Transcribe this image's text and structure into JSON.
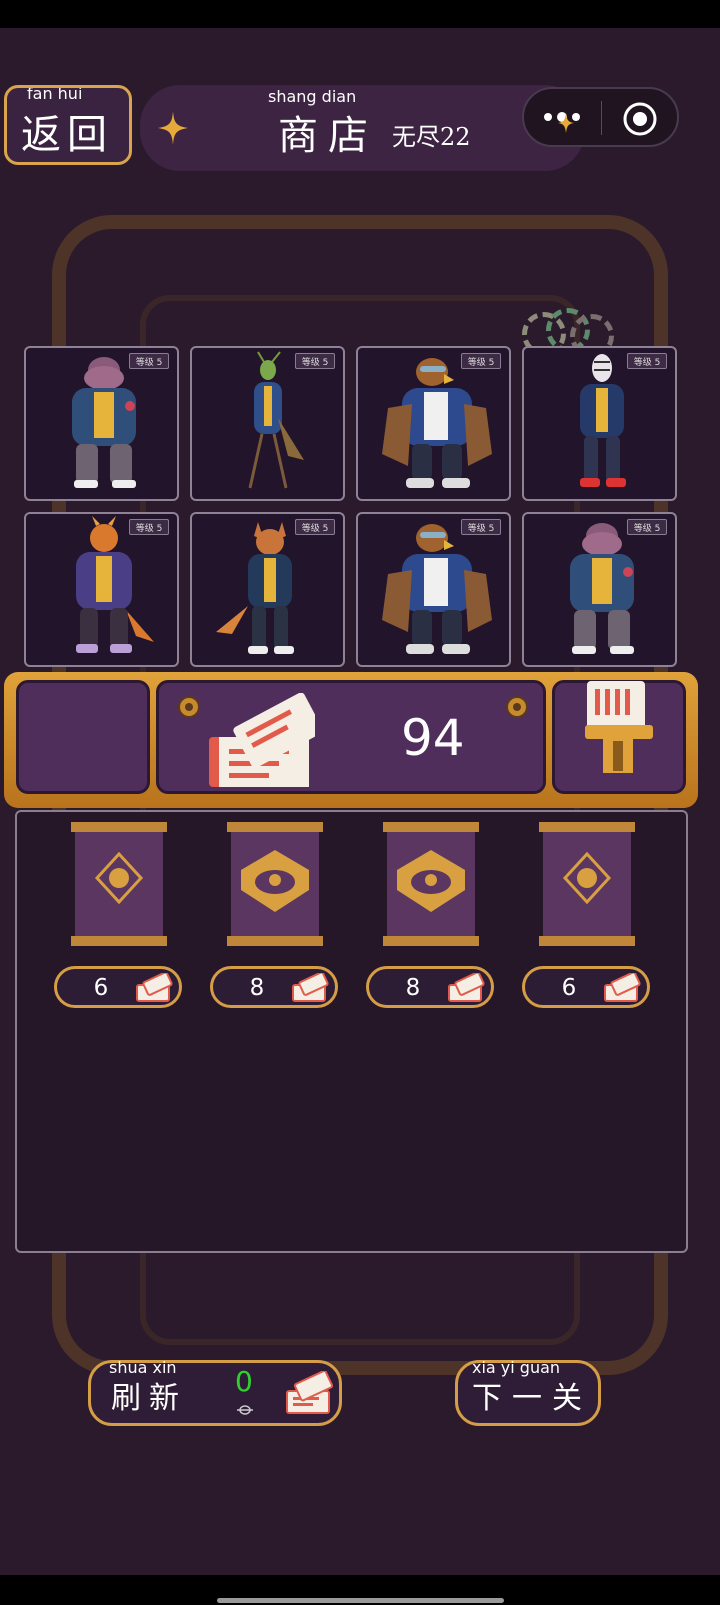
{
  "header": {
    "back": {
      "pinyin": "fan  hui",
      "label": "返回"
    },
    "shop": {
      "pinyin": "shang dian",
      "label": "商店",
      "mode": "无尽22"
    }
  },
  "collection": {
    "cards": [
      {
        "animal": "hippo",
        "level_label": "等级 5"
      },
      {
        "animal": "mantis",
        "level_label": "等级 5"
      },
      {
        "animal": "eagle",
        "level_label": "等级 5"
      },
      {
        "animal": "zebra",
        "level_label": "等级 5"
      },
      {
        "animal": "dragon",
        "level_label": "等级 5"
      },
      {
        "animal": "fox",
        "level_label": "等级 5"
      },
      {
        "animal": "eagle",
        "level_label": "等级 5"
      },
      {
        "animal": "hippo",
        "level_label": "等级 5"
      }
    ]
  },
  "currency": {
    "tickets": "94",
    "icon": "ticket-icon"
  },
  "shop": {
    "packs": [
      {
        "emblem": "small",
        "price": "6"
      },
      {
        "emblem": "large",
        "price": "8"
      },
      {
        "emblem": "large",
        "price": "8"
      },
      {
        "emblem": "small",
        "price": "6"
      }
    ]
  },
  "footer": {
    "refresh": {
      "pinyin": "shua  xin",
      "label": "刷新",
      "cost": "0"
    },
    "next": {
      "pinyin": "xia   yi  guan",
      "label": "下一关"
    }
  },
  "colors": {
    "gold": "#d9a44c",
    "panel": "#261728",
    "cost_green": "#2fd12f"
  }
}
